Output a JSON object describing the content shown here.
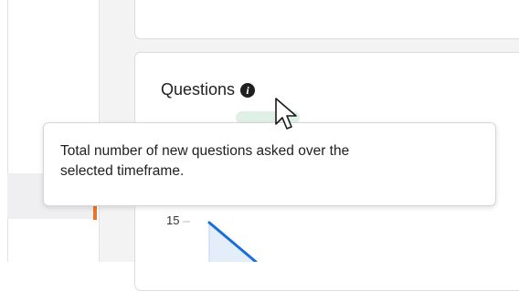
{
  "questions_card": {
    "title": "Questions",
    "info_icon": "info-icon"
  },
  "tooltip": {
    "line1": "Total number of new questions asked over the",
    "line2": "selected timeframe."
  },
  "chart": {
    "y_tick_label": "15",
    "line_color": "#1a6ed8",
    "fill_color": "#e4eefb"
  },
  "colors": {
    "accent_marker": "#e8742a",
    "background": "#f3f3f4"
  }
}
